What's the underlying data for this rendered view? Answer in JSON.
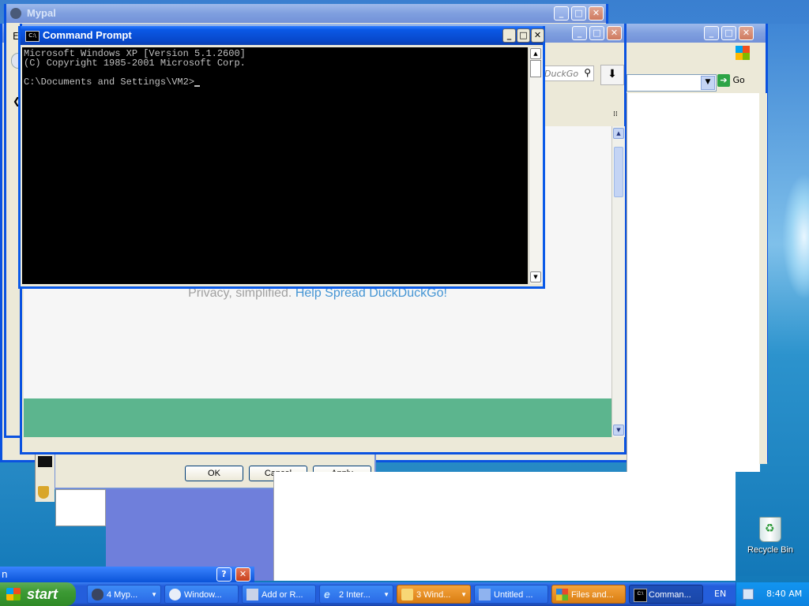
{
  "windows": {
    "mypal": {
      "title": "Mypal",
      "menu_letter": "E"
    },
    "ie_back": {
      "sidebar_letter": "n"
    },
    "browser_mid": {
      "search_placeholder": "DuckGo",
      "tagline_plain": "Privacy, simplified.",
      "tagline_link": "Help Spread DuckDuckGo!"
    },
    "explorer": {
      "go_label": "Go"
    },
    "add_remove_dialog": {
      "ok_label": "OK",
      "cancel_label": "Cancel",
      "apply_label": "Apply"
    },
    "cmd": {
      "title": "Command Prompt",
      "line1": "Microsoft Windows XP [Version 5.1.2600]",
      "line2": "(C) Copyright 1985-2001 Microsoft Corp.",
      "line3": "",
      "prompt": "C:\\Documents and Settings\\VM2>"
    }
  },
  "desktop": {
    "recycle_bin_label": "Recycle Bin"
  },
  "taskbar": {
    "start_label": "start",
    "tasks": [
      {
        "label": "4 Myp...",
        "icon": "mypal-icon"
      },
      {
        "label": "Window...",
        "icon": "media-icon"
      },
      {
        "label": "Add or R...",
        "icon": "add-remove-icon"
      },
      {
        "label": "2 Inter...",
        "icon": "ie-icon"
      },
      {
        "label": "3 Wind...",
        "icon": "folder-icon"
      },
      {
        "label": "Untitled ...",
        "icon": "paint-icon"
      },
      {
        "label": "Files and...",
        "icon": "files-icon"
      },
      {
        "label": "Comman...",
        "icon": "cmd-icon"
      }
    ],
    "language": "EN",
    "clock": "8:40 AM"
  },
  "colors": {
    "xp_blue": "#0a58e6",
    "ddg_green": "#5cb58e",
    "link_blue": "#4495d4"
  }
}
